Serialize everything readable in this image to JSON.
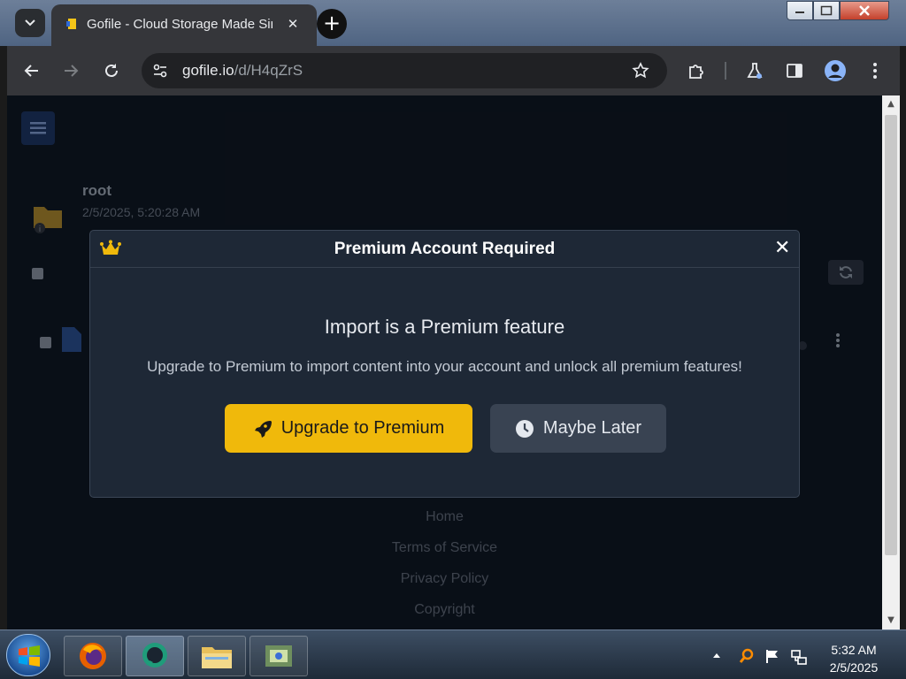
{
  "browser": {
    "tab_title": "Gofile - Cloud Storage Made Simple",
    "tab_close": "✕",
    "new_tab": "+",
    "url_host": "gofile.io",
    "url_path": "/d/H4qZrS"
  },
  "page": {
    "folder_name": "root",
    "folder_date": "2/5/2025, 5:20:28 AM",
    "footer_links": [
      "Home",
      "Terms of Service",
      "Privacy Policy",
      "Copyright"
    ]
  },
  "modal": {
    "title": "Premium Account Required",
    "close_label": "✕",
    "heading": "Import is a Premium feature",
    "description": "Upgrade to Premium to import content into your account and unlock all premium features!",
    "upgrade_label": "Upgrade to Premium",
    "later_label": "Maybe Later"
  },
  "taskbar": {
    "time": "5:32 AM",
    "date": "2/5/2025"
  },
  "colors": {
    "accent": "#f0b90b",
    "page_bg": "#0f1724",
    "modal_bg": "#1e2836"
  }
}
